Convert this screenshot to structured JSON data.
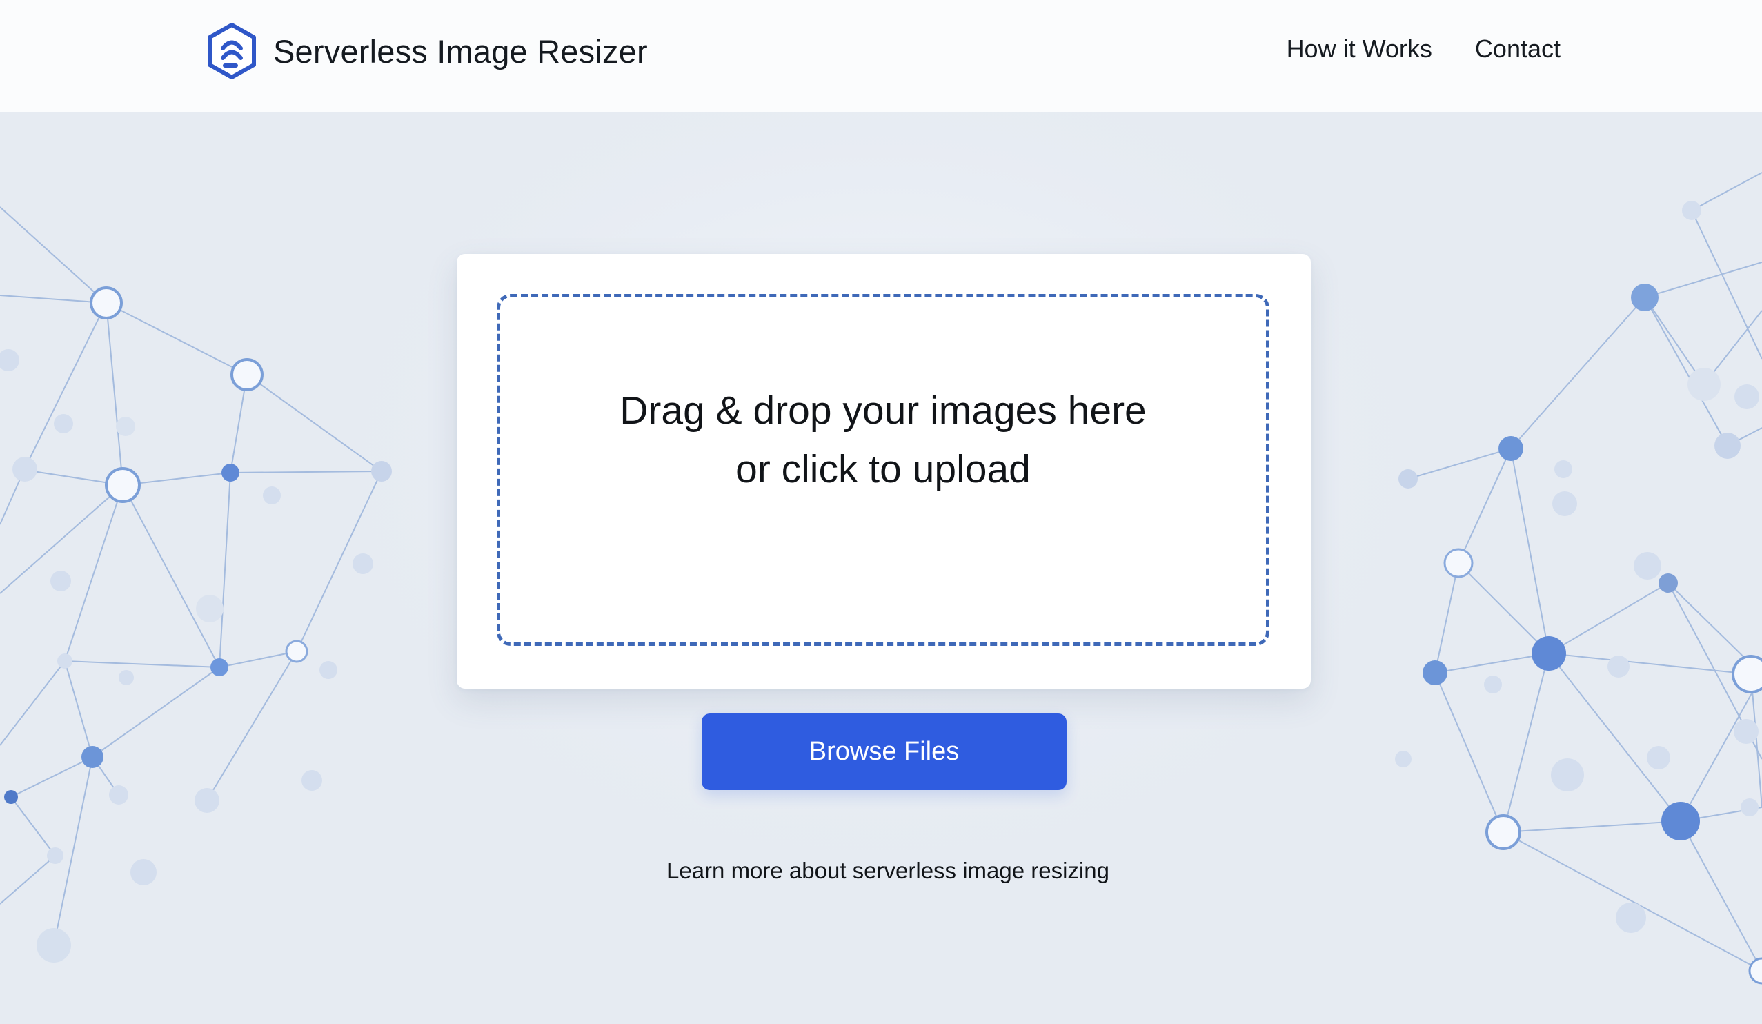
{
  "header": {
    "brand_title": "Serverless Image Resizer",
    "nav_items": [
      {
        "label": "How it Works"
      },
      {
        "label": "Contact"
      }
    ]
  },
  "upload": {
    "line1": "Drag & drop your images here",
    "line2": "or click to upload",
    "browse_button_label": "Browse Files"
  },
  "footer": {
    "learn_more": "Learn more about serverless image resizing"
  },
  "colors": {
    "accent": "#2f5ce0",
    "dashed_border": "#3f69b8",
    "network_line": "#9db6dc",
    "network_node": "#6f97d8",
    "page_background": "#e6ebf2"
  },
  "icons": {
    "brand_logo": "hexagon-logo",
    "decoration": "network-graph"
  }
}
